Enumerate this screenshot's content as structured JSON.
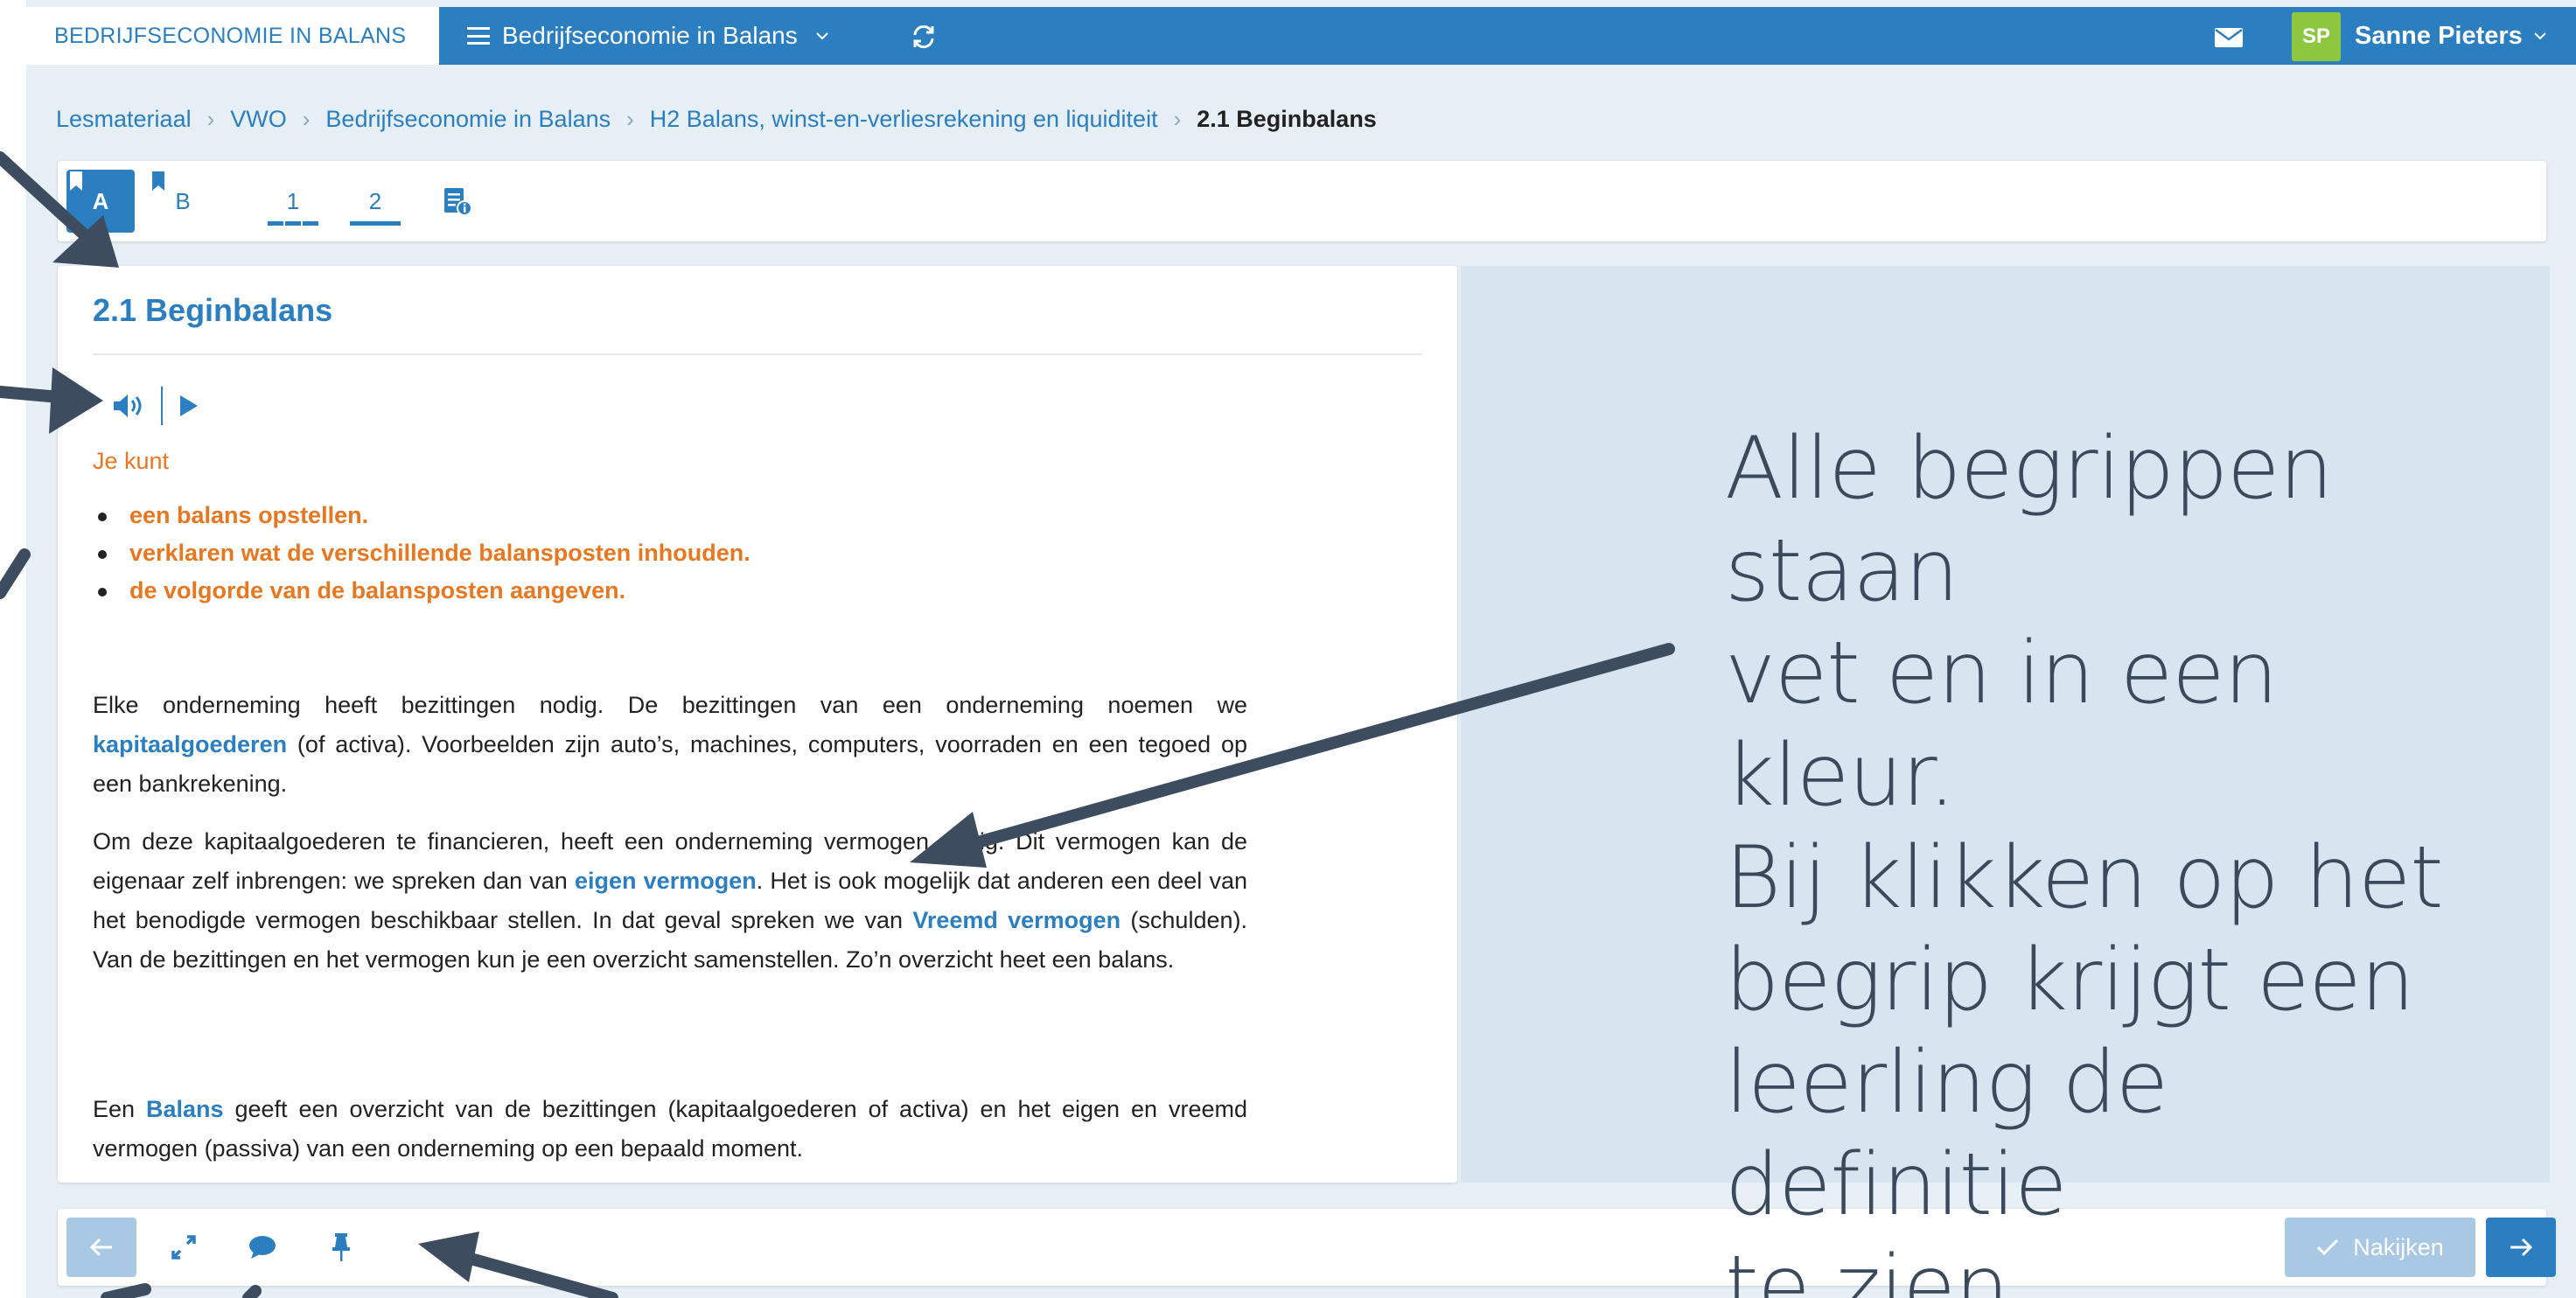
{
  "topbar": {
    "brand": "BEDRIJFSECONOMIE IN BALANS",
    "course_menu_label": "Bedrijfseconomie in Balans",
    "user_initials": "SP",
    "user_name": "Sanne Pieters",
    "icons": [
      "menu-icon",
      "refresh-icon",
      "mail-icon",
      "chevron-down-icon"
    ],
    "colors": {
      "bar": "#2b7fc1",
      "avatar": "#8dc63f"
    }
  },
  "breadcrumb": {
    "items": [
      "Lesmateriaal",
      "VWO",
      "Bedrijfseconomie in Balans",
      "H2 Balans, winst-en-verliesrekening en liquiditeit"
    ],
    "current": "2.1 Beginbalans"
  },
  "tabs": {
    "a": "A",
    "b": "B",
    "one": "1",
    "two": "2"
  },
  "content": {
    "title": "2.1 Beginbalans",
    "goals_title": "Je kunt",
    "goals": [
      "een balans opstellen.",
      "verklaren wat de verschillende balansposten inhouden.",
      "de volgorde van de balansposten aangeven."
    ],
    "p1": {
      "a": "Elke onderneming heeft bezittingen nodig. De bezittingen van een onderneming noemen we ",
      "term": "kapitaalgoederen",
      "b": " (of activa). Voorbeelden zijn auto’s, machines, computers, voorraden en een tegoed op een bankrekening."
    },
    "p2": {
      "a": "Om deze kapitaalgoederen te financieren, heeft een onderneming vermogen nodig. Dit vermogen kan de eigenaar zelf inbrengen: we spreken dan van ",
      "term1": "eigen vermogen",
      "b": ". Het is ook mogelijk dat anderen een deel van het benodigde vermogen beschikbaar stellen. In dat geval spreken we van ",
      "term2": "Vreemd vermogen",
      "c": " (schulden). Van de bezittingen en het vermogen kun je een overzicht samenstellen. Zo’n overzicht heet een balans."
    },
    "p3": {
      "a": "Een ",
      "term": "Balans",
      "b": " geeft een overzicht van de bezittingen (kapitaalgoederen of activa) en het eigen en vreemd vermogen (passiva) van een onderneming op een bepaald moment."
    }
  },
  "annotation": {
    "lines": [
      "Alle begrippen staan",
      "vet en in een kleur.",
      "Bij klikken op het",
      "begrip krijgt een",
      "leerling de definitie",
      "te zien."
    ]
  },
  "bottom": {
    "check_label": "Nakijken",
    "icons": [
      "arrow-left-icon",
      "expand-icon",
      "comment-icon",
      "pin-icon",
      "check-icon",
      "arrow-right-icon"
    ]
  }
}
